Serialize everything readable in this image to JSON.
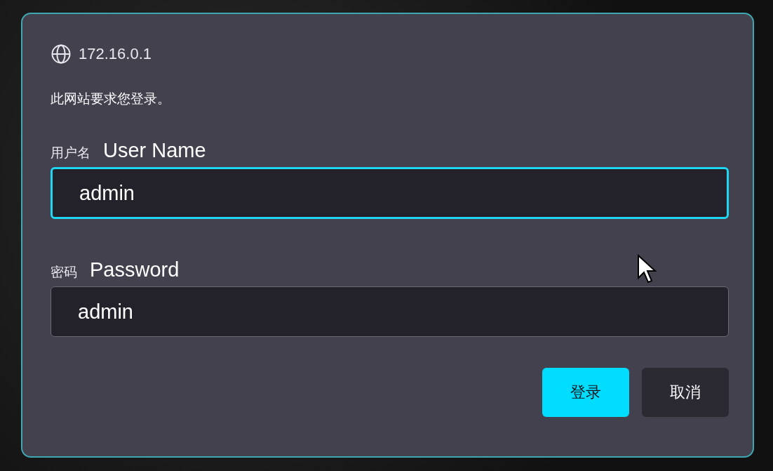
{
  "dialog": {
    "site": "172.16.0.1",
    "message": "此网站要求您登录。",
    "fields": [
      {
        "label": "用户名",
        "annotation": "User Name",
        "value": "admin",
        "focused": true
      },
      {
        "label": "密码",
        "annotation": "Password",
        "value": "admin",
        "focused": false
      }
    ],
    "buttons": [
      {
        "label": "登录",
        "kind": "primary"
      },
      {
        "label": "取消",
        "kind": "secondary"
      }
    ]
  }
}
